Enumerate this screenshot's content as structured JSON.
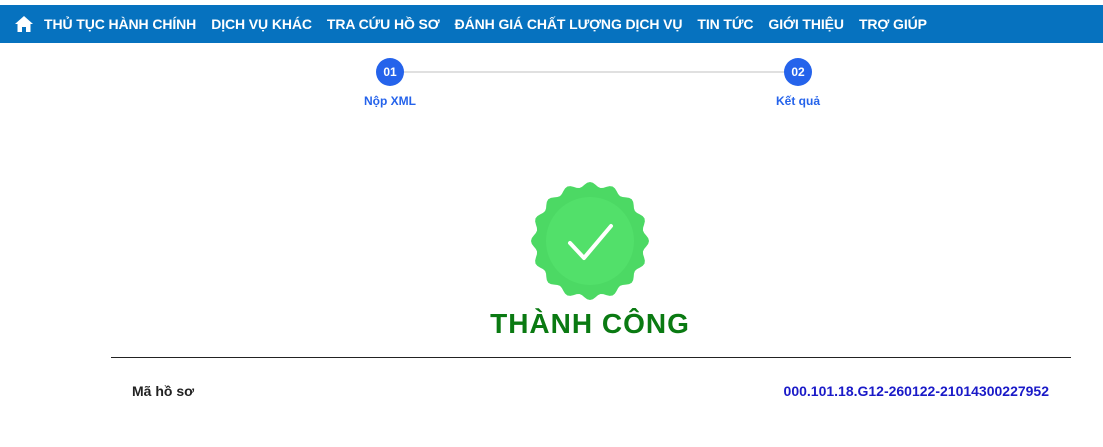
{
  "nav": {
    "home_icon": "home-icon",
    "items": [
      "THỦ TỤC HÀNH CHÍNH",
      "DỊCH VỤ KHÁC",
      "TRA CỨU HỒ SƠ",
      "ĐÁNH GIÁ CHẤT LƯỢNG DỊCH VỤ",
      "TIN TỨC",
      "GIỚI THIỆU",
      "TRỢ GIÚP"
    ]
  },
  "stepper": {
    "steps": [
      {
        "number": "01",
        "label": "Nộp XML"
      },
      {
        "number": "02",
        "label": "Kết quả"
      }
    ]
  },
  "result": {
    "icon": "checkmark-badge-icon",
    "title": "THÀNH CÔNG"
  },
  "info": {
    "label": "Mã hồ sơ",
    "value": "000.101.18.G12-260122-21014300227952"
  },
  "colors": {
    "nav_bg": "#0672bf",
    "step_blue": "#2563eb",
    "success_green": "#0a7a12",
    "badge_green": "#4cd964",
    "code_blue": "#1a1ac8"
  }
}
